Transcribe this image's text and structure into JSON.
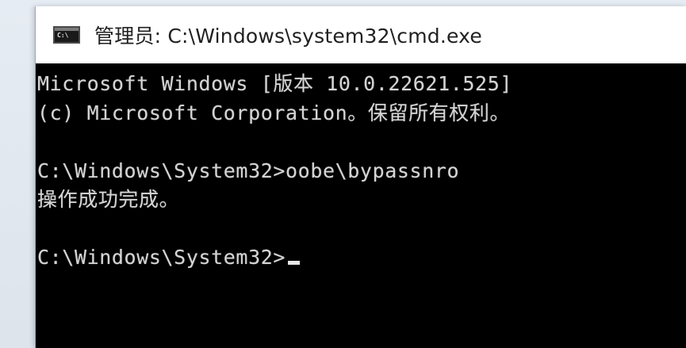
{
  "window": {
    "title": "管理员: C:\\Windows\\system32\\cmd.exe",
    "icon": "console-icon"
  },
  "console": {
    "lines": [
      "Microsoft Windows [版本 10.0.22621.525]",
      "(c) Microsoft Corporation。保留所有权利。",
      "",
      "C:\\Windows\\System32>oobe\\bypassnro",
      "操作成功完成。",
      "",
      "C:\\Windows\\System32>"
    ]
  },
  "colors": {
    "console_background": "#000000",
    "console_text": "#d4d4d4",
    "titlebar_background": "#ffffff"
  }
}
